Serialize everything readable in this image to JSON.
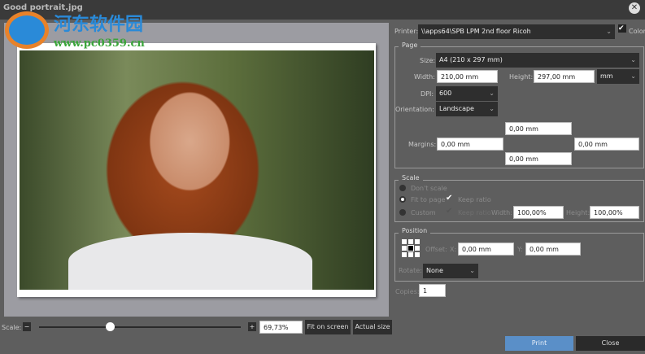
{
  "window": {
    "title": "Good portrait.jpg",
    "close_icon": "close-icon"
  },
  "watermark": {
    "text": "河东软件园",
    "url": "www.pc0359.cn"
  },
  "preview": {
    "scale_label": "Scale:",
    "zoom_value": "69,73%",
    "slider_fraction": 0.35,
    "fit_on_screen": "Fit on screen",
    "actual_size": "Actual size",
    "minus": "−",
    "plus": "+"
  },
  "printer": {
    "label": "Printer:",
    "value": "\\\\apps64\\SPB LPM 2nd floor Ricoh",
    "color_label": "Color",
    "color_checked": true
  },
  "page": {
    "title": "Page",
    "size_label": "Size:",
    "size_value": "A4 (210 x 297 mm)",
    "width_label": "Width:",
    "width_value": "210,00 mm",
    "height_label": "Height:",
    "height_value": "297,00 mm",
    "unit": "mm",
    "dpi_label": "DPI:",
    "dpi_value": "600",
    "orientation_label": "Orientation:",
    "orientation_value": "Landscape",
    "margins_label": "Margins:",
    "margin_top": "0,00 mm",
    "margin_left": "0,00 mm",
    "margin_right": "0,00 mm",
    "margin_bottom": "0,00 mm"
  },
  "scale": {
    "title": "Scale",
    "dont_scale": "Don't scale",
    "fit_to_page": "Fit to page",
    "keep_ratio": "Keep ratio",
    "custom": "Custom",
    "keep_ratio2": "Keep ratio",
    "width_label": "Width:",
    "width_value": "100,00%",
    "height_label": "Height:",
    "height_value": "100,00%",
    "selected": "Fit to page"
  },
  "position": {
    "title": "Position",
    "offset_label": "Offset:",
    "x_label": "X:",
    "x_value": "0,00 mm",
    "y_label": "Y:",
    "y_value": "0,00 mm",
    "rotate_label": "Rotate:",
    "rotate_value": "None"
  },
  "copies": {
    "label": "Copies:",
    "value": "1"
  },
  "actions": {
    "print": "Print",
    "close": "Close"
  }
}
